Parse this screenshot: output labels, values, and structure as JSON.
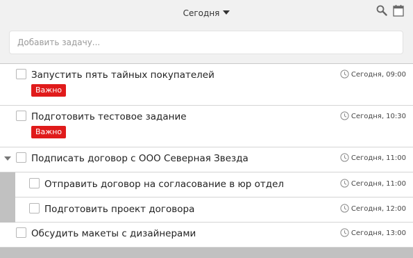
{
  "header": {
    "title": "Сегодня",
    "search_icon": "search-icon",
    "calendar_icon": "calendar-icon"
  },
  "add_task": {
    "placeholder": "Добавить задачу..."
  },
  "tasks": [
    {
      "label": "Запустить пять тайных покупателей",
      "time": "Сегодня, 09:00",
      "badge": "Важно"
    },
    {
      "label": "Подготовить тестовое задание",
      "time": "Сегодня, 10:30",
      "badge": "Важно"
    },
    {
      "label": "Подписать договор с ООО Северная Звезда",
      "time": "Сегодня, 11:00",
      "subtasks": [
        {
          "label": "Отправить договор на согласование в юр отдел",
          "time": "Сегодня, 11:00"
        },
        {
          "label": "Подготовить проект договора",
          "time": "Сегодня, 12:00"
        }
      ]
    },
    {
      "label": "Обсудить макеты с дизайнерами",
      "time": "Сегодня, 13:00"
    }
  ],
  "colors": {
    "badge": "#e01b1b",
    "header_bg": "#f1f1f1",
    "gutter": "#c1c1c1"
  }
}
